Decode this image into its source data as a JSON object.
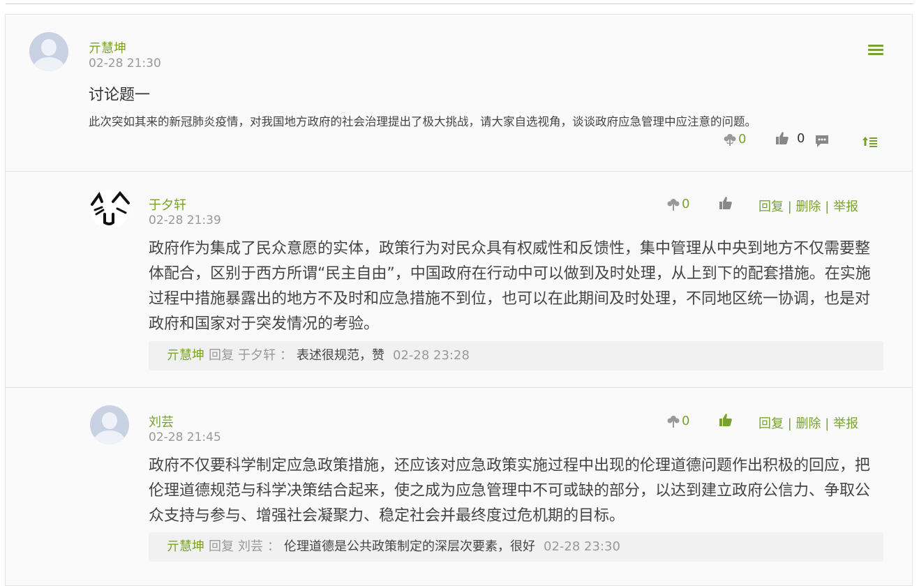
{
  "topic": {
    "author": "亓慧坤",
    "time": "02-28 21:30",
    "title": "讨论题一",
    "body": "此次突如其来的新冠肺炎疫情，对我国地方政府的社会治理提出了极大挑战，请大家自选视角，谈谈政府应急管理中应注意的问题。",
    "flower_count": "0",
    "like_count": "0",
    "menu_icon": "hamburger-menu-icon",
    "sort_icon": "sort-asc-icon"
  },
  "replies": [
    {
      "author": "于夕轩",
      "time": "02-28 21:39",
      "flower_count": "0",
      "liked": false,
      "body": "政府作为集成了民众意愿的实体，政策行为对民众具有权威性和反馈性，集中管理从中央到地方不仅需要整体配合，区别于西方所谓“民主自由”，中国政府在行动中可以做到及时处理，从上到下的配套措施。在实施过程中措施暴露出的地方不及时和应急措施不到位，也可以在此期间及时处理，不同地区统一协调，也是对政府和国家对于突发情况的考验。",
      "actions": {
        "reply": "回复",
        "delete": "删除",
        "report": "举报",
        "sep": "|"
      },
      "sub_reply": {
        "from": "亓慧坤",
        "verb": "回复",
        "to": "于夕轩",
        "colon": "：",
        "text": "表述很规范，赞",
        "time": "02-28 23:28"
      }
    },
    {
      "author": "刘芸",
      "time": "02-28 21:45",
      "flower_count": "0",
      "liked": true,
      "body": "政府不仅要科学制定应急政策措施，还应该对应急政策实施过程中出现的伦理道德问题作出积极的回应，把伦理道德规范与科学决策结合起来，使之成为应急管理中不可或缺的部分，以达到建立政府公信力、争取公众支持与参与、增强社会凝聚力、稳定社会并最终度过危机期的目标。",
      "actions": {
        "reply": "回复",
        "delete": "删除",
        "report": "举报",
        "sep": "|"
      },
      "sub_reply": {
        "from": "亓慧坤",
        "verb": "回复",
        "to": "刘芸",
        "colon": "：",
        "text": "伦理道德是公共政策制定的深层次要素，很好",
        "time": "02-28 23:30"
      }
    }
  ],
  "colors": {
    "accent": "#78a22f",
    "muted": "#999999",
    "icon_gray": "#888888"
  }
}
